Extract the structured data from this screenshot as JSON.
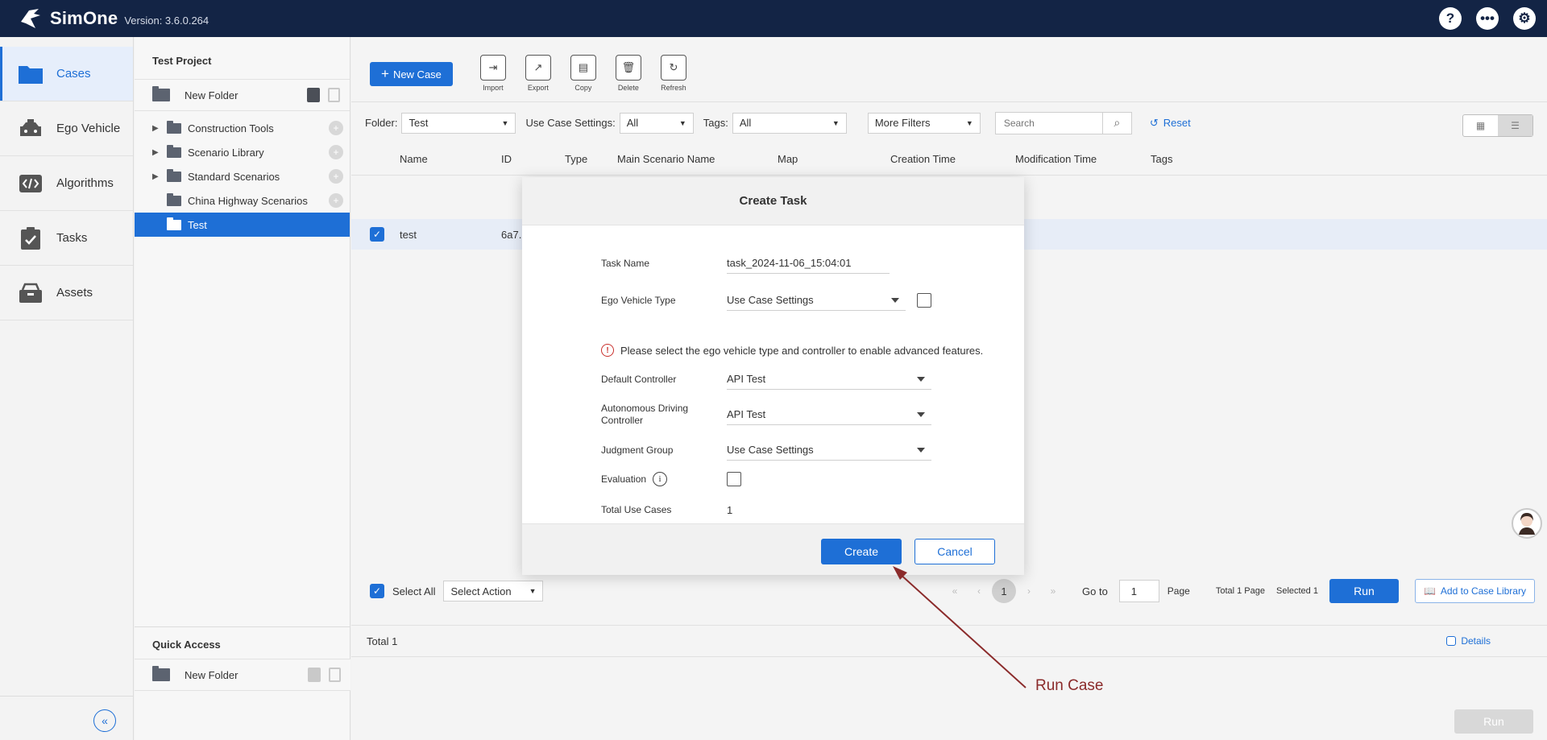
{
  "app": {
    "name": "SimOne",
    "version": "Version: 3.6.0.264",
    "top_icons": [
      "help-icon",
      "more-icon",
      "settings-icon"
    ]
  },
  "nav": {
    "items": [
      {
        "label": "Cases",
        "icon": "cases-folder-icon",
        "active": true
      },
      {
        "label": "Ego Vehicle",
        "icon": "car-icon"
      },
      {
        "label": "Algorithms",
        "icon": "code-icon"
      },
      {
        "label": "Tasks",
        "icon": "tasks-check-icon"
      },
      {
        "label": "Assets",
        "icon": "assets-box-icon"
      }
    ]
  },
  "tree": {
    "project_title": "Test Project",
    "new_folder": "New Folder",
    "folders": [
      {
        "label": "Construction Tools",
        "expandable": true
      },
      {
        "label": "Scenario Library",
        "expandable": true
      },
      {
        "label": "Standard Scenarios",
        "expandable": true
      },
      {
        "label": "China Highway Scenarios",
        "expandable": false
      },
      {
        "label": "Test",
        "expandable": false,
        "selected": true
      }
    ],
    "quick_access_title": "Quick Access",
    "quick_new_folder": "New Folder"
  },
  "toolbar": {
    "new_case": "New Case",
    "tools": [
      {
        "label": "Import",
        "icon": "import-icon"
      },
      {
        "label": "Export",
        "icon": "export-icon"
      },
      {
        "label": "Copy",
        "icon": "copy-icon"
      },
      {
        "label": "Delete",
        "icon": "delete-icon"
      },
      {
        "label": "Refresh",
        "icon": "refresh-icon"
      }
    ]
  },
  "filters": {
    "folder_label": "Folder:",
    "folder_value": "Test",
    "use_case_settings_label": "Use Case Settings:",
    "use_case_settings_value": "All",
    "tags_label": "Tags:",
    "tags_value": "All",
    "more_filters": "More Filters",
    "search_placeholder": "Search",
    "reset": "Reset"
  },
  "table": {
    "headers": [
      "Name",
      "ID",
      "Type",
      "Main Scenario Name",
      "Map",
      "Creation Time",
      "Modification Time",
      "Tags"
    ],
    "rows": [
      {
        "name": "test",
        "id": "6a7.",
        "checked": true
      }
    ]
  },
  "footer": {
    "select_all": "Select All",
    "select_action": "Select Action",
    "current_page": "1",
    "go_to": "Go to",
    "go_to_value": "1",
    "page": "Page",
    "total_pages": "Total 1 Page",
    "selected": "Selected 1",
    "run": "Run",
    "add_to_library": "Add to Case Library",
    "total": "Total 1",
    "details": "Details",
    "run_disabled": "Run"
  },
  "dialog": {
    "title": "Create Task",
    "task_name_label": "Task Name",
    "task_name_value": "task_2024-11-06_15:04:01",
    "ego_vehicle_type_label": "Ego Vehicle Type",
    "ego_vehicle_type_value": "Use Case Settings",
    "warning": "Please select the ego vehicle type and controller to enable advanced features.",
    "default_controller_label": "Default Controller",
    "default_controller_value": "API Test",
    "ad_controller_label": "Autonomous Driving Controller",
    "ad_controller_value": "API Test",
    "judgment_group_label": "Judgment Group",
    "judgment_group_value": "Use Case Settings",
    "evaluation_label": "Evaluation",
    "total_use_cases_label": "Total Use Cases",
    "total_use_cases_value": "1",
    "create": "Create",
    "cancel": "Cancel"
  },
  "annotation": {
    "label": "Run Case",
    "color": "#8b2b2b"
  },
  "colors": {
    "topbar": "#132445",
    "accent": "#1e6fd6"
  }
}
